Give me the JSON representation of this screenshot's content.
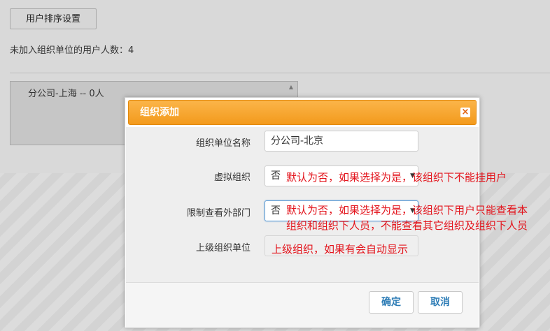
{
  "background": {
    "sort_button_label": "用户排序设置",
    "unassigned_text": "未加入组织单位的用户人数：4",
    "list_items": [
      "分公司-上海 -- 0人"
    ]
  },
  "dialog": {
    "title": "组织添加",
    "close_symbol": "×",
    "fields": {
      "name": {
        "label": "组织单位名称",
        "value": "分公司-北京"
      },
      "virtual": {
        "label": "虚拟组织",
        "value": "否",
        "note": "默认为否，如果选择为是，该组织下不能挂用户"
      },
      "restrict": {
        "label": "限制查看外部门",
        "value": "否",
        "note_line1": "默认为否，如果选择为是，该组织下用户只能查看本",
        "note_line2": "组织和组织下人员，不能查看其它组织及组织下人员"
      },
      "parent": {
        "label": "上级组织单位",
        "placeholder": "上级组织，如果有会自动显示"
      }
    },
    "buttons": {
      "confirm": "确定",
      "cancel": "取消"
    }
  },
  "colors": {
    "dialog_header": "#f5a62a",
    "annotation_red": "#e3141c",
    "button_text": "#2b7bb5"
  }
}
